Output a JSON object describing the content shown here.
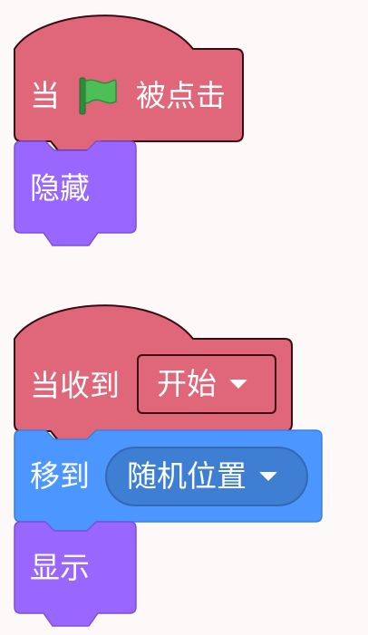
{
  "script1": {
    "hat_prefix": "当",
    "flag_icon": "green-flag-icon",
    "hat_suffix": "被点击",
    "hide_block": "隐藏"
  },
  "script2": {
    "hat_label": "当收到",
    "message_value": "开始",
    "move_label": "移到",
    "move_target": "随机位置",
    "show_block": "显示"
  },
  "colors": {
    "events": "#e0667a",
    "looks": "#9966ff",
    "motion": "#4c97ff",
    "background": "#fdf9f8"
  }
}
